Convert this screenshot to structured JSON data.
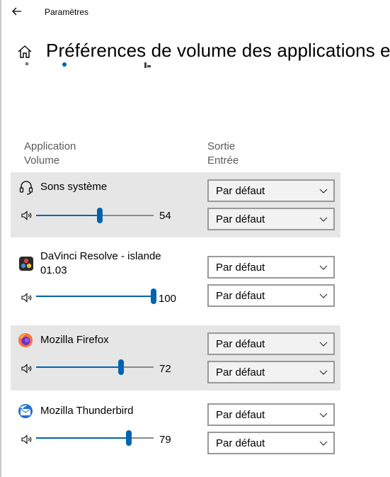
{
  "window": {
    "title": "Paramètres"
  },
  "page": {
    "title": "Préférences de volume des applications et des appareils"
  },
  "headers": {
    "application": "Application",
    "volume": "Volume",
    "sortie": "Sortie",
    "entree": "Entrée"
  },
  "apps": [
    {
      "name": "Sons système",
      "volume": "54",
      "level": 54,
      "output": "Par défaut",
      "input": "Par défaut",
      "icon": "headset-icon"
    },
    {
      "name": "DaVinci Resolve - islande",
      "name2": "01.03",
      "volume": "100",
      "level": 100,
      "output": "Par défaut",
      "input": "Par défaut",
      "icon": "davinci-resolve-icon"
    },
    {
      "name": "Mozilla Firefox",
      "volume": "72",
      "level": 72,
      "output": "Par défaut",
      "input": "Par défaut",
      "icon": "firefox-icon"
    },
    {
      "name": "Mozilla Thunderbird",
      "volume": "79",
      "level": 79,
      "output": "Par défaut",
      "input": "Par défaut",
      "icon": "thunderbird-icon"
    }
  ],
  "colors": {
    "accent": "#0063b1",
    "shaded_row": "#e6e6e6"
  }
}
